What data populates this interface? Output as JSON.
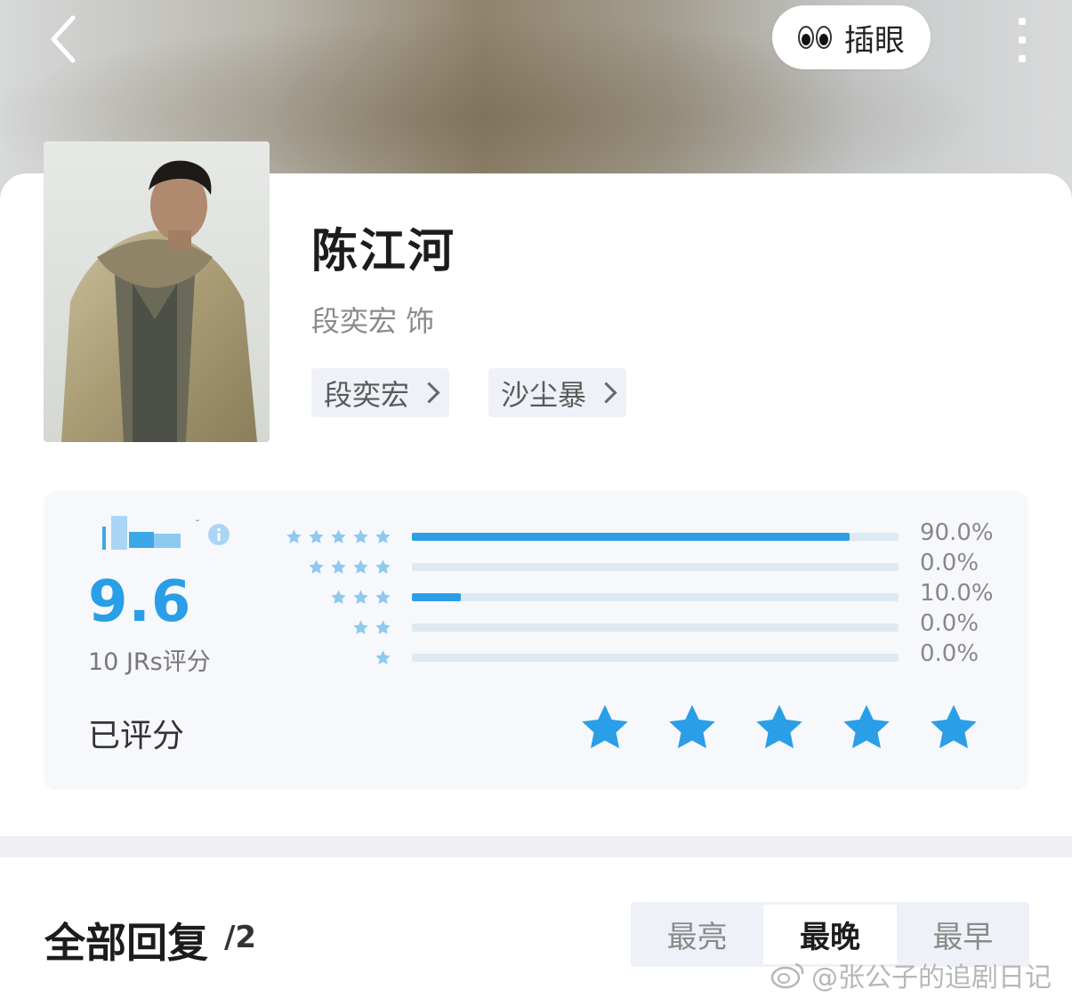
{
  "header": {
    "back_icon": "chevron-left-icon",
    "peek_label": "插眼",
    "peek_icon": "eyes-emoji-icon",
    "more_icon": "vertical-dots-icon"
  },
  "character": {
    "name": "陈江河",
    "role": "段奕宏 饰",
    "tags": [
      "段奕宏",
      "沙尘暴"
    ]
  },
  "rating": {
    "score": "9.6",
    "count_text": "10 JRs评分",
    "rated_label": "已评分",
    "user_stars": 5,
    "accent_color": "#2a9ee6",
    "distribution": [
      {
        "stars": 5,
        "percent": 90.0,
        "label": "90.0%"
      },
      {
        "stars": 4,
        "percent": 0.0,
        "label": "0.0%"
      },
      {
        "stars": 3,
        "percent": 10.0,
        "label": "10.0%"
      },
      {
        "stars": 2,
        "percent": 0.0,
        "label": "0.0%"
      },
      {
        "stars": 1,
        "percent": 0.0,
        "label": "0.0%"
      }
    ]
  },
  "replies": {
    "title": "全部回复",
    "count": "/2",
    "sort_tabs": [
      {
        "label": "最亮",
        "active": false
      },
      {
        "label": "最晚",
        "active": true
      },
      {
        "label": "最早",
        "active": false
      }
    ]
  },
  "watermark": "@张公子的追剧日记"
}
